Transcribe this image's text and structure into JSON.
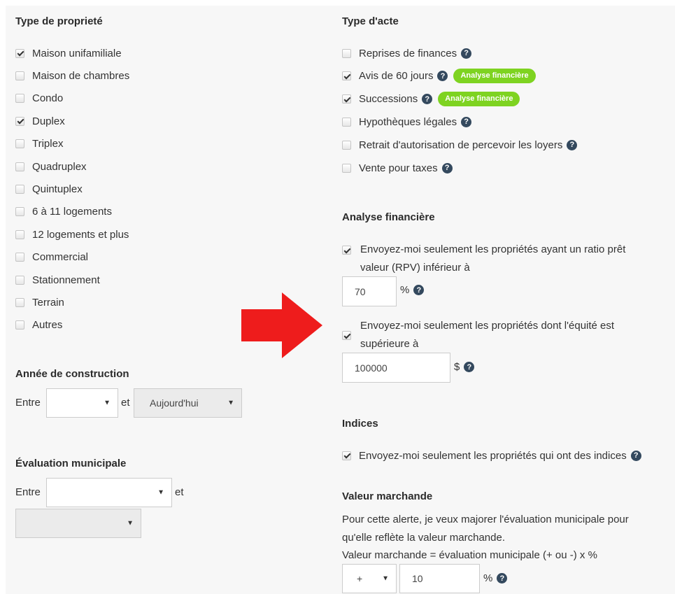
{
  "property_type": {
    "title": "Type de proprieté",
    "items": [
      {
        "label": "Maison unifamiliale",
        "checked": true
      },
      {
        "label": "Maison de chambres",
        "checked": false
      },
      {
        "label": "Condo",
        "checked": false
      },
      {
        "label": "Duplex",
        "checked": true
      },
      {
        "label": "Triplex",
        "checked": false
      },
      {
        "label": "Quadruplex",
        "checked": false
      },
      {
        "label": "Quintuplex",
        "checked": false
      },
      {
        "label": "6 à 11 logements",
        "checked": false
      },
      {
        "label": "12 logements et plus",
        "checked": false
      },
      {
        "label": "Commercial",
        "checked": false
      },
      {
        "label": "Stationnement",
        "checked": false
      },
      {
        "label": "Terrain",
        "checked": false
      },
      {
        "label": "Autres",
        "checked": false
      }
    ]
  },
  "construction_year": {
    "title": "Année de construction",
    "between": "Entre",
    "and": "et",
    "from_value": "",
    "to_value": "Aujourd'hui"
  },
  "municipal_eval": {
    "title": "Évaluation municipale",
    "between": "Entre",
    "and": "et",
    "from_value": "",
    "to_value": ""
  },
  "act_type": {
    "title": "Type d'acte",
    "items": [
      {
        "label": "Reprises de finances",
        "checked": false,
        "badge": ""
      },
      {
        "label": "Avis de 60 jours",
        "checked": true,
        "badge": "Analyse financière"
      },
      {
        "label": "Successions",
        "checked": true,
        "badge": "Analyse financière"
      },
      {
        "label": "Hypothèques légales",
        "checked": false,
        "badge": ""
      },
      {
        "label": "Retrait d'autorisation de percevoir les loyers",
        "checked": false,
        "badge": ""
      },
      {
        "label": "Vente pour taxes",
        "checked": false,
        "badge": ""
      }
    ]
  },
  "financial_analysis": {
    "title": "Analyse financière",
    "ratio_line1": "Envoyez-moi seulement les propriétés ayant un ratio prêt",
    "ratio_line2": "valeur (RPV) inférieur à",
    "ratio_checked": true,
    "ratio_value": "70",
    "ratio_unit": "%",
    "equity_line1": "Envoyez-moi seulement les propriétés dont l'équité est",
    "equity_line2": "supérieure à",
    "equity_checked": true,
    "equity_value": "100000",
    "equity_unit": "$"
  },
  "clues": {
    "title": "Indices",
    "label": "Envoyez-moi seulement les propriétés qui ont des indices",
    "checked": true
  },
  "market_value": {
    "title": "Valeur marchande",
    "desc_line1": "Pour cette alerte, je veux majorer l'évaluation municipale pour",
    "desc_line2": "qu'elle reflète la valeur marchande.",
    "formula": "Valeur marchande = évaluation municipale (+ ou -) x %",
    "sign_value": "+",
    "percent_value": "10",
    "unit": "%"
  },
  "icons": {
    "help": "question-circle-icon",
    "arrow": "red-right-arrow-icon",
    "caret": "caret-down-icon"
  },
  "colors": {
    "badge": "#7ed321",
    "help": "#34495e",
    "arrow": "#ee1c1c",
    "panel": "#f7f7f7"
  }
}
